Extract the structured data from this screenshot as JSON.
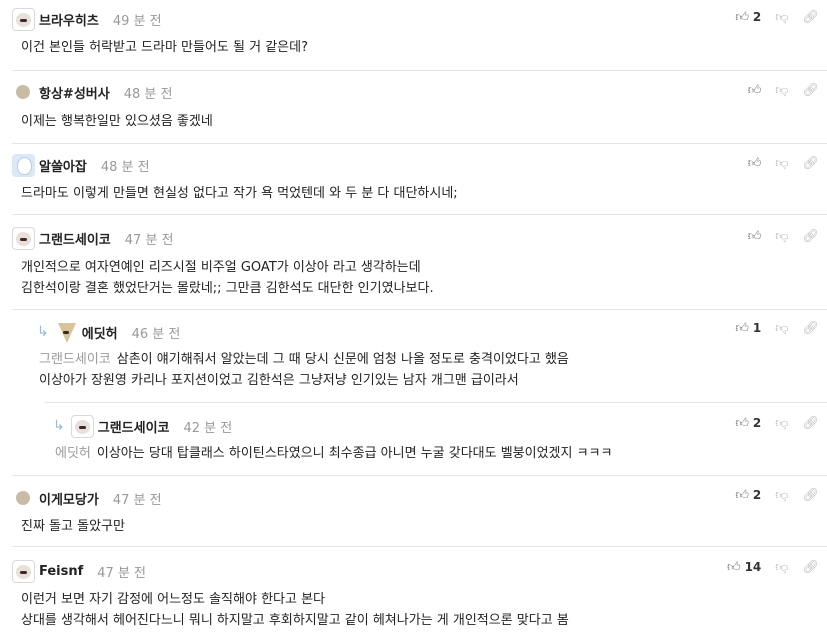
{
  "comments": [
    {
      "nick": "브라우히츠",
      "time": "49 분 전",
      "lines": [
        "이건 본인들 허락받고 드라마 만들어도 될 거 같은데?"
      ],
      "likes": "2"
    },
    {
      "nick": "항상#성버사",
      "time": "48 분 전",
      "lines": [
        "이제는 행복한일만 있으셨음 좋겠네"
      ],
      "likes": ""
    },
    {
      "nick": "알쓸아잡",
      "time": "48 분 전",
      "lines": [
        "드라마도 이렇게 만들면 현실성 없다고 작가 욕 먹었텐데 와 두 분 다 대단하시네;"
      ],
      "likes": ""
    },
    {
      "nick": "그랜드세이코",
      "time": "47 분 전",
      "lines": [
        "개인적으로 여자연예인 리즈시절 비주얼 GOAT가 이상아 라고 생각하는데",
        "김한석이랑 결혼 했었단거는 몰랐네;; 그만큼 김한석도 대단한 인기였나보다."
      ],
      "likes": ""
    },
    {
      "nick": "에딧허",
      "time": "46 분 전",
      "mention": "그랜드세이코",
      "lines": [
        "삼촌이 얘기해줘서 알았는데 그 때 당시 신문에 엄청 나올 정도로 충격이었다고 했음",
        "이상아가 장원영 카리나 포지션이었고 김한석은 그냥저냥 인기있는 남자 개그맨 급이라서"
      ],
      "likes": "1"
    },
    {
      "nick": "그랜드세이코",
      "time": "42 분 전",
      "mention": "에딧허",
      "lines": [
        "이상아는 당대 탑클래스 하이틴스타였으니 최수종급 아니면 누굴 갖다대도 벨붕이었겠지 ㅋㅋㅋ"
      ],
      "likes": "2"
    },
    {
      "nick": "이게모당가",
      "time": "47 분 전",
      "lines": [
        "진짜 돌고 돌았구만"
      ],
      "likes": "2"
    },
    {
      "nick": "Feisnf",
      "time": "47 분 전",
      "lines": [
        "이런거 보면 자기 감정에 어느정도 솔직해야 한다고 본다",
        "상대를 생각해서 헤어진다느니 뭐니 하지말고 후회하지말고 같이 헤쳐나가는 게 개인적으론 맞다고 봄"
      ],
      "likes": "14"
    }
  ],
  "icons": {
    "like": "thumbs-up-icon",
    "dislike": "thumbs-down-icon",
    "link": "link-icon",
    "reply": "reply-arrow-icon"
  }
}
